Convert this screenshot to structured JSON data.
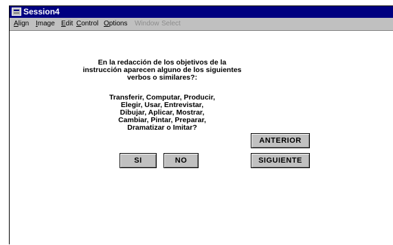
{
  "window": {
    "title": "Session4"
  },
  "menu": [
    {
      "label": "Align",
      "accel": "A",
      "rest": "lign",
      "enabled": true
    },
    {
      "label": "Image",
      "accel": "I",
      "rest": "mage",
      "enabled": true
    },
    {
      "label": "Edit",
      "accel": "E",
      "rest": "dit",
      "enabled": true
    },
    {
      "label": "Control",
      "accel": "C",
      "rest": "ontrol",
      "enabled": true
    },
    {
      "label": "Options",
      "accel": "O",
      "rest": "ptions",
      "enabled": true
    },
    {
      "label": "Window",
      "accel": "W",
      "rest": "indow",
      "enabled": false
    },
    {
      "label": "Select",
      "accel": "S",
      "rest": "elect",
      "enabled": false
    }
  ],
  "content": {
    "question_lines": [
      "En la redacción de los objetivos de la",
      "instrucción aparecen alguno de los siguientes",
      "verbos o similares?:"
    ],
    "verbs_lines": [
      "Transferir, Computar, Producir,",
      "Elegir, Usar, Entrevistar,",
      "Dibujar, Aplicar, Mostrar,",
      "Cambiar, Pintar, Preparar,",
      "Dramatizar o Imitar?"
    ]
  },
  "buttons": {
    "anterior": "ANTERIOR",
    "si": "SI",
    "no": "NO",
    "siguiente": "SIGUIENTE"
  }
}
